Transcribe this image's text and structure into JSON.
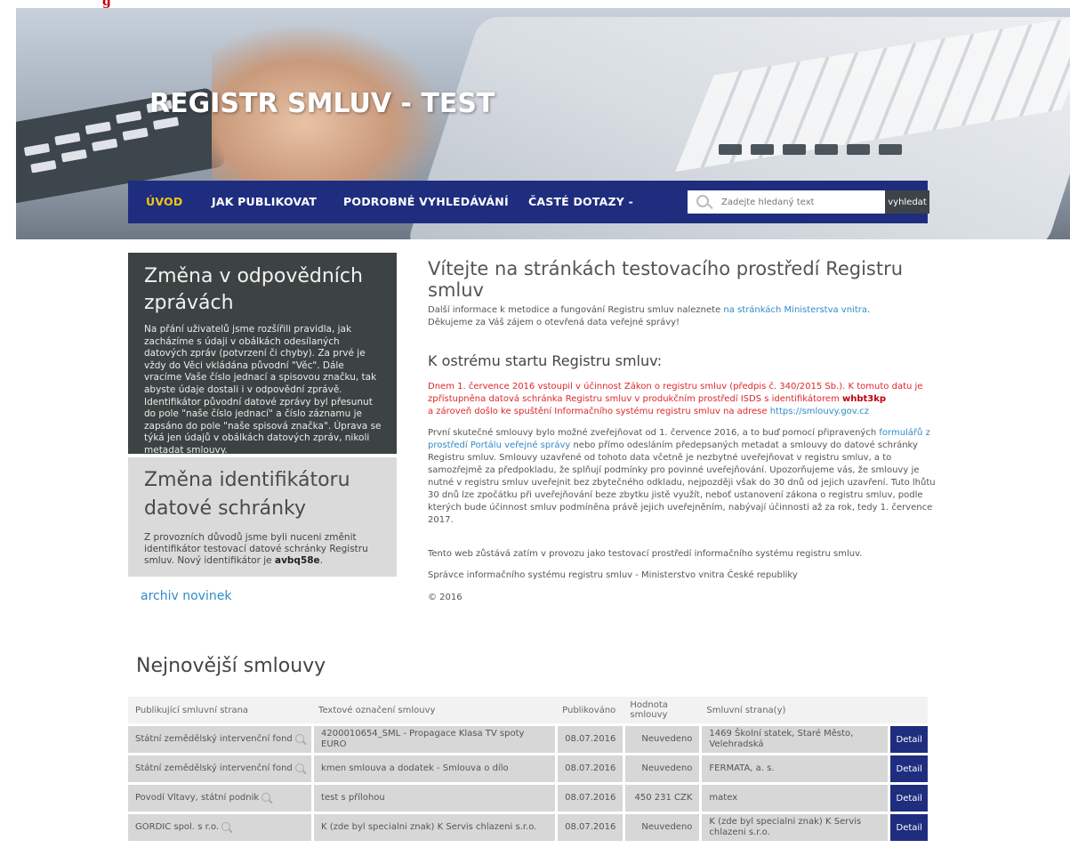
{
  "top_marker": "g",
  "site": {
    "title": "REGISTR SMLUV - TEST"
  },
  "nav": {
    "items": [
      "ÚVOD",
      "JAK PUBLIKOVAT",
      "PODROBNÉ VYHLEDÁVÁNÍ",
      "ČASTÉ DOTAZY -"
    ],
    "active_index": 0,
    "search_placeholder": "Zadejte hledaný text",
    "search_button": "vyhledat"
  },
  "colors": {
    "nav_bg": "#1f2d7f",
    "active_nav": "#f2c511",
    "link": "#2e8bc8",
    "warning": "#e0262c",
    "detail_button": "#1f2d7f"
  },
  "news": [
    {
      "title": "Změna v odpovědních zprávách",
      "text": "Na přání uživatelů jsme rozšířili pravidla, jak zacházíme s údaji v obálkách odesílaných datových zpráv (potvrzení či chyby). Za prvé je vždy do Věci vkládána původní \"Věc\". Dále vracíme Vaše číslo jednací a spisovou značku, tak abyste údaje dostali i v odpovědní zprávě. Identifikátor původní datové zprávy byl přesunut do pole \"naše číslo jednací\" a číslo záznamu je zapsáno do pole \"naše spisová značka\". Úprava se týká jen údajů v obálkách datových zpráv, nikoli metadat smlouvy."
    },
    {
      "title": "Změna identifikátoru datové schránky",
      "text": "Z provozních důvodů jsme byli nuceni změnit identifikátor testovací datové schránky Registru smluv. Nový identifikátor je ",
      "bold": "avbq58e",
      "after": "."
    }
  ],
  "archive_link": "archiv novinek",
  "main": {
    "heading": "Vítejte na stránkách testovacího prostředí Registru smluv",
    "intro_text": "Další informace k metodice a fungování Registru smluv naleznete ",
    "intro_link": "na stránkách Ministerstva vnitra",
    "intro_end": ".",
    "intro_line2": "Děkujeme za Váš zájem o otevřená data veřejné správy!",
    "subheading": "K ostrému startu Registru smluv:",
    "warning_text": "Dnem 1. července 2016 vstoupil v účinnost Zákon o registru smluv (předpis č. 340/2015 Sb.). K tomuto datu je zpřístupněna datová schránka Registru smluv v produkčním prostředí ISDS s identifikátorem ",
    "warning_bold": "whbt3kp",
    "warning_text2": "a zároveň došlo ke spuštění Informačního systému registru smluv na adrese ",
    "warning_link": "https://smlouvy.gov.cz",
    "p3_text1": "První skutečné smlouvy bylo možné zveřejňovat od 1. července 2016, a to buď pomocí připravených ",
    "p3_link": "formulářů z prostředí Portálu veřejné správy",
    "p3_text2": " nebo přímo odesláním předepsaných metadat a smlouvy do datové schránky Registru smluv. Smlouvy uzavřené od tohoto data včetně je nezbytné uveřejňovat v registru smluv, a to samozřejmě za předpokladu, že splňují podmínky pro povinné uveřejňování. Upozorňujeme vás, že smlouvy je nutné v registru smluv uveřejnit bez zbytečného odkladu, nejpozději však do 30 dnů od jejich uzavření. Tuto lhůtu 30 dnů lze zpočátku při uveřejňování beze zbytku jistě využít, neboť ustanovení zákona o registru smluv, podle kterých bude účinnost smluv podmíněna právě jejich uveřejněním, nabývají účinnosti až za rok, tedy 1. července 2017.",
    "p4": "Tento web zůstává zatím v provozu jako testovací prostředí informačního systému registru smluv.",
    "p5": "Správce informačního systému registru smluv - Ministerstvo vnitra České republiky",
    "p6": "© 2016"
  },
  "latest": {
    "title": "Nejnovější smlouvy",
    "columns": [
      "Publikující smluvní strana",
      "Textové označení smlouvy",
      "Publikováno",
      "Hodnota smlouvy",
      "Smluvní strana(y)"
    ],
    "detail_label": "Detail",
    "rows": [
      {
        "publisher": "Státní zemědělský intervenční fond",
        "subject": "4200010654_SML - Propagace Klasa TV spoty EURO",
        "published": "08.07.2016",
        "value": "Neuvedeno",
        "party": "1469 Školní statek, Staré Město, Velehradská"
      },
      {
        "publisher": "Státní zemědělský intervenční fond",
        "subject": "kmen smlouva a dodatek - Smlouva o dílo",
        "published": "08.07.2016",
        "value": "Neuvedeno",
        "party": "FERMATA, a. s."
      },
      {
        "publisher": "Povodí Vltavy, státní podnik",
        "subject": "test s přílohou",
        "published": "08.07.2016",
        "value": "450 231 CZK",
        "party": "matex"
      },
      {
        "publisher": "GORDIC spol. s r.o.",
        "subject": "K (zde byl specialni znak) K Servis chlazeni s.r.o.",
        "published": "08.07.2016",
        "value": "Neuvedeno",
        "party": "K (zde byl specialni znak) K Servis chlazeni s.r.o."
      }
    ]
  }
}
